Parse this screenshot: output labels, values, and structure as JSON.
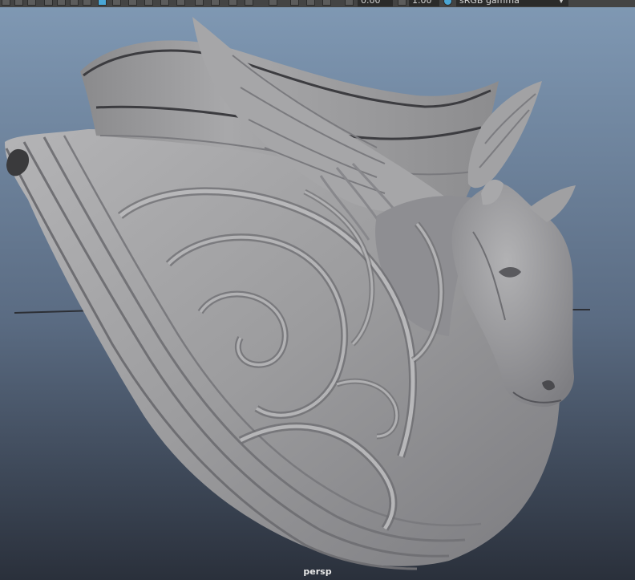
{
  "toolbar": {
    "exposure_value": "0.00",
    "gamma_value": "1.00",
    "color_space": "sRGB gamma",
    "icons": [
      "select-icon",
      "lasso-icon",
      "paint-icon",
      "grid-icon",
      "film-icon",
      "camera-icon",
      "wireframe-icon",
      "shaded-icon",
      "textured-icon",
      "lights-icon",
      "shadow-icon",
      "ambient-occlusion-icon",
      "motion-blur-icon",
      "anti-alias-icon",
      "xray-icon",
      "isolate-icon",
      "exposure-icon",
      "gamma-icon",
      "color-space-icon"
    ]
  },
  "viewport": {
    "camera_label": "persp",
    "background_top": "#7f98b3",
    "background_bottom": "#2a303b",
    "model_color": "#9a9a9c"
  }
}
